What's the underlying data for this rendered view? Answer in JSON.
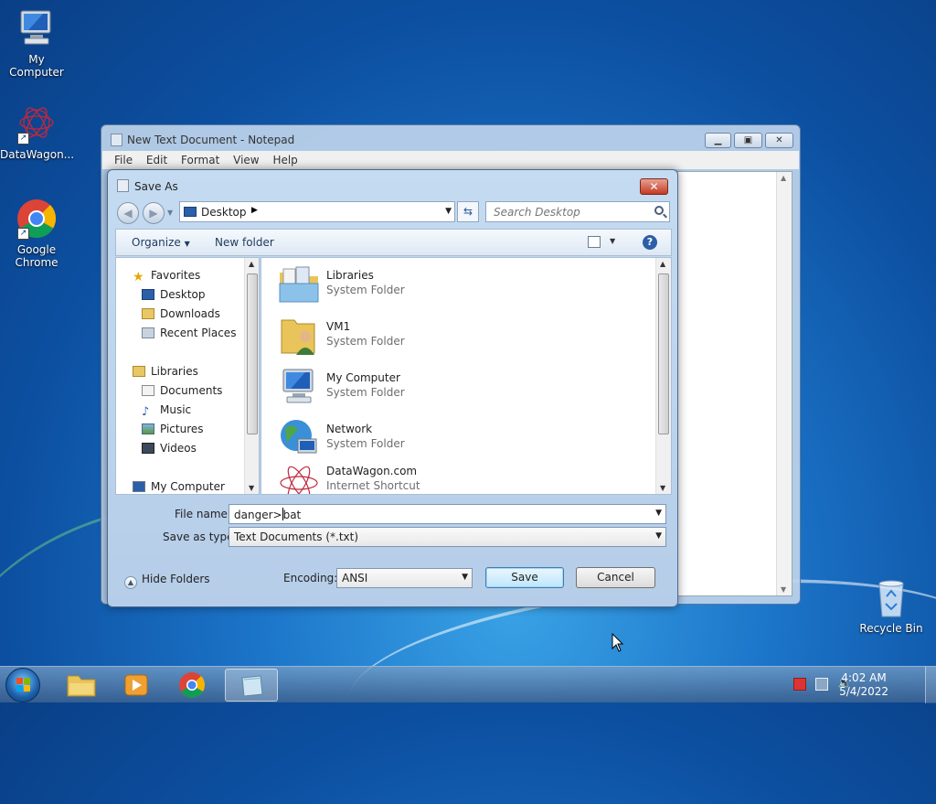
{
  "desktop": {
    "icons": [
      {
        "label": "My Computer"
      },
      {
        "label": "DataWagon..."
      },
      {
        "label": "Google Chrome"
      },
      {
        "label": "Recycle Bin"
      }
    ]
  },
  "notepad": {
    "title": "New Text Document - Notepad",
    "menu": [
      "File",
      "Edit",
      "Format",
      "View",
      "Help"
    ]
  },
  "dialog": {
    "title": "Save As",
    "close_icon": "close-icon",
    "address": {
      "location": "Desktop"
    },
    "search": {
      "placeholder": "Search Desktop"
    },
    "toolbar": {
      "organize": "Organize",
      "new_folder": "New folder"
    },
    "nav": {
      "favorites": "Favorites",
      "favorites_items": [
        "Desktop",
        "Downloads",
        "Recent Places"
      ],
      "libraries": "Libraries",
      "libraries_items": [
        "Documents",
        "Music",
        "Pictures",
        "Videos"
      ],
      "computer": "My Computer"
    },
    "files": [
      {
        "name": "Libraries",
        "type": "System Folder"
      },
      {
        "name": "VM1",
        "type": "System Folder"
      },
      {
        "name": "My Computer",
        "type": "System Folder"
      },
      {
        "name": "Network",
        "type": "System Folder"
      },
      {
        "name": "DataWagon.com",
        "type": "Internet Shortcut"
      }
    ],
    "file_name_label": "File name:",
    "file_name_before_caret": "danger>",
    "file_name_after_caret": "bat",
    "save_type_label": "Save as type:",
    "save_type_value": "Text Documents (*.txt)",
    "hide_folders": "Hide Folders",
    "encoding_label": "Encoding:",
    "encoding_value": "ANSI",
    "save_button": "Save",
    "cancel_button": "Cancel"
  },
  "taskbar": {
    "time": "4:02 AM",
    "date": "5/4/2022"
  }
}
